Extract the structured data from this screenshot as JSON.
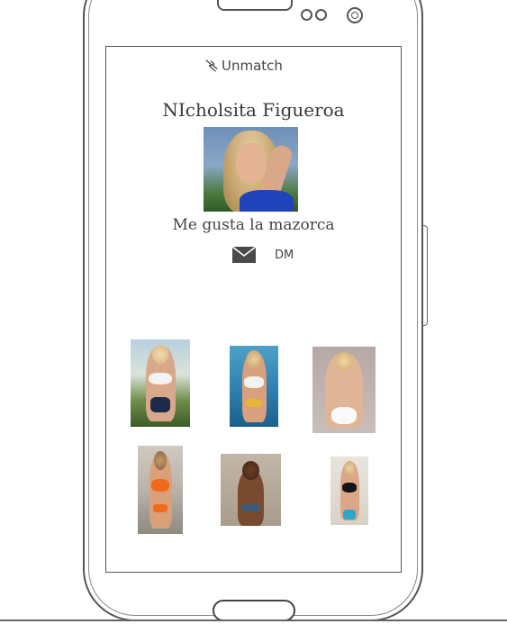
{
  "header": {
    "unmatch_label": "Unmatch"
  },
  "profile": {
    "name": "NIcholsita Figueroa",
    "bio": "Me gusta la mazorca"
  },
  "actions": {
    "dm_label": "DM"
  },
  "icons": {
    "unmatch": "broken-heart-bolt-icon",
    "dm": "envelope-icon"
  },
  "colors": {
    "frame": "#555555",
    "swimsuit_blue": "#1f43b8",
    "orange_bikini": "#f06a1c",
    "yellow_bikini": "#e6b53a"
  }
}
